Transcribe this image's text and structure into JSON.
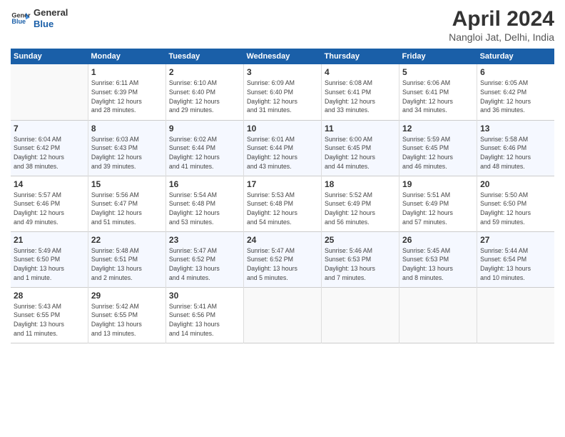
{
  "logo": {
    "line1": "General",
    "line2": "Blue"
  },
  "title": "April 2024",
  "subtitle": "Nangloi Jat, Delhi, India",
  "weekdays": [
    "Sunday",
    "Monday",
    "Tuesday",
    "Wednesday",
    "Thursday",
    "Friday",
    "Saturday"
  ],
  "weeks": [
    [
      {
        "day": "",
        "info": ""
      },
      {
        "day": "1",
        "info": "Sunrise: 6:11 AM\nSunset: 6:39 PM\nDaylight: 12 hours\nand 28 minutes."
      },
      {
        "day": "2",
        "info": "Sunrise: 6:10 AM\nSunset: 6:40 PM\nDaylight: 12 hours\nand 29 minutes."
      },
      {
        "day": "3",
        "info": "Sunrise: 6:09 AM\nSunset: 6:40 PM\nDaylight: 12 hours\nand 31 minutes."
      },
      {
        "day": "4",
        "info": "Sunrise: 6:08 AM\nSunset: 6:41 PM\nDaylight: 12 hours\nand 33 minutes."
      },
      {
        "day": "5",
        "info": "Sunrise: 6:06 AM\nSunset: 6:41 PM\nDaylight: 12 hours\nand 34 minutes."
      },
      {
        "day": "6",
        "info": "Sunrise: 6:05 AM\nSunset: 6:42 PM\nDaylight: 12 hours\nand 36 minutes."
      }
    ],
    [
      {
        "day": "7",
        "info": "Sunrise: 6:04 AM\nSunset: 6:42 PM\nDaylight: 12 hours\nand 38 minutes."
      },
      {
        "day": "8",
        "info": "Sunrise: 6:03 AM\nSunset: 6:43 PM\nDaylight: 12 hours\nand 39 minutes."
      },
      {
        "day": "9",
        "info": "Sunrise: 6:02 AM\nSunset: 6:44 PM\nDaylight: 12 hours\nand 41 minutes."
      },
      {
        "day": "10",
        "info": "Sunrise: 6:01 AM\nSunset: 6:44 PM\nDaylight: 12 hours\nand 43 minutes."
      },
      {
        "day": "11",
        "info": "Sunrise: 6:00 AM\nSunset: 6:45 PM\nDaylight: 12 hours\nand 44 minutes."
      },
      {
        "day": "12",
        "info": "Sunrise: 5:59 AM\nSunset: 6:45 PM\nDaylight: 12 hours\nand 46 minutes."
      },
      {
        "day": "13",
        "info": "Sunrise: 5:58 AM\nSunset: 6:46 PM\nDaylight: 12 hours\nand 48 minutes."
      }
    ],
    [
      {
        "day": "14",
        "info": "Sunrise: 5:57 AM\nSunset: 6:46 PM\nDaylight: 12 hours\nand 49 minutes."
      },
      {
        "day": "15",
        "info": "Sunrise: 5:56 AM\nSunset: 6:47 PM\nDaylight: 12 hours\nand 51 minutes."
      },
      {
        "day": "16",
        "info": "Sunrise: 5:54 AM\nSunset: 6:48 PM\nDaylight: 12 hours\nand 53 minutes."
      },
      {
        "day": "17",
        "info": "Sunrise: 5:53 AM\nSunset: 6:48 PM\nDaylight: 12 hours\nand 54 minutes."
      },
      {
        "day": "18",
        "info": "Sunrise: 5:52 AM\nSunset: 6:49 PM\nDaylight: 12 hours\nand 56 minutes."
      },
      {
        "day": "19",
        "info": "Sunrise: 5:51 AM\nSunset: 6:49 PM\nDaylight: 12 hours\nand 57 minutes."
      },
      {
        "day": "20",
        "info": "Sunrise: 5:50 AM\nSunset: 6:50 PM\nDaylight: 12 hours\nand 59 minutes."
      }
    ],
    [
      {
        "day": "21",
        "info": "Sunrise: 5:49 AM\nSunset: 6:50 PM\nDaylight: 13 hours\nand 1 minute."
      },
      {
        "day": "22",
        "info": "Sunrise: 5:48 AM\nSunset: 6:51 PM\nDaylight: 13 hours\nand 2 minutes."
      },
      {
        "day": "23",
        "info": "Sunrise: 5:47 AM\nSunset: 6:52 PM\nDaylight: 13 hours\nand 4 minutes."
      },
      {
        "day": "24",
        "info": "Sunrise: 5:47 AM\nSunset: 6:52 PM\nDaylight: 13 hours\nand 5 minutes."
      },
      {
        "day": "25",
        "info": "Sunrise: 5:46 AM\nSunset: 6:53 PM\nDaylight: 13 hours\nand 7 minutes."
      },
      {
        "day": "26",
        "info": "Sunrise: 5:45 AM\nSunset: 6:53 PM\nDaylight: 13 hours\nand 8 minutes."
      },
      {
        "day": "27",
        "info": "Sunrise: 5:44 AM\nSunset: 6:54 PM\nDaylight: 13 hours\nand 10 minutes."
      }
    ],
    [
      {
        "day": "28",
        "info": "Sunrise: 5:43 AM\nSunset: 6:55 PM\nDaylight: 13 hours\nand 11 minutes."
      },
      {
        "day": "29",
        "info": "Sunrise: 5:42 AM\nSunset: 6:55 PM\nDaylight: 13 hours\nand 13 minutes."
      },
      {
        "day": "30",
        "info": "Sunrise: 5:41 AM\nSunset: 6:56 PM\nDaylight: 13 hours\nand 14 minutes."
      },
      {
        "day": "",
        "info": ""
      },
      {
        "day": "",
        "info": ""
      },
      {
        "day": "",
        "info": ""
      },
      {
        "day": "",
        "info": ""
      }
    ]
  ]
}
